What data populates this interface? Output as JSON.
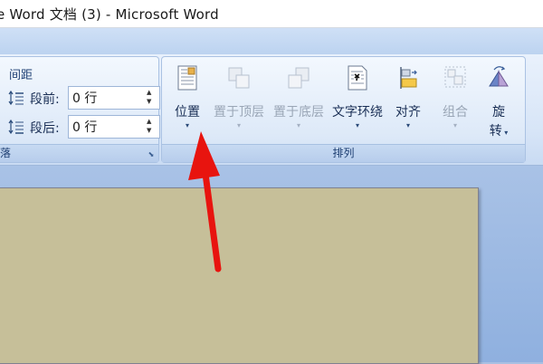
{
  "window": {
    "title": "e Word 文档 (3) - Microsoft Word"
  },
  "paragraph_group": {
    "spacing_title": "间距",
    "before_label": "段前:",
    "before_value": "0 行",
    "after_label": "段后:",
    "after_value": "0 行",
    "group_label": "落"
  },
  "arrange_group": {
    "group_label": "排列",
    "buttons": [
      {
        "label": "位置",
        "enabled": true,
        "icon": "position-icon"
      },
      {
        "label": "置于顶层",
        "enabled": false,
        "icon": "bring-to-front-icon"
      },
      {
        "label": "置于底层",
        "enabled": false,
        "icon": "send-to-back-icon"
      },
      {
        "label": "文字环绕",
        "enabled": true,
        "icon": "text-wrap-icon"
      },
      {
        "label": "对齐",
        "enabled": true,
        "icon": "align-icon"
      },
      {
        "label": "组合",
        "enabled": false,
        "icon": "group-icon"
      },
      {
        "label": "旋",
        "label2": "转",
        "enabled": true,
        "icon": "rotate-icon"
      }
    ]
  },
  "annotation": {
    "color": "#e8140f"
  }
}
